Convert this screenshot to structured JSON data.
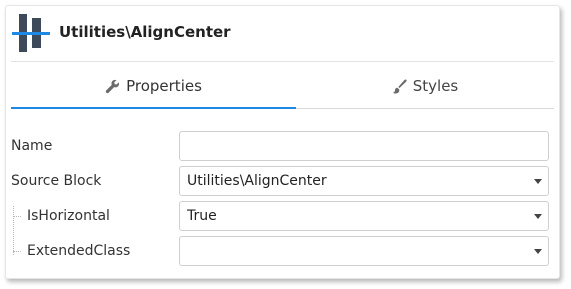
{
  "header": {
    "icon": "align-center-icon",
    "title": "Utilities\\AlignCenter"
  },
  "tabs": [
    {
      "label": "Properties",
      "icon": "wrench-icon",
      "active": true
    },
    {
      "label": "Styles",
      "icon": "brush-icon",
      "active": false
    }
  ],
  "properties": [
    {
      "label": "Name",
      "value": "",
      "type": "text"
    },
    {
      "label": "Source Block",
      "value": "Utilities\\AlignCenter",
      "type": "select"
    },
    {
      "label": "IsHorizontal",
      "value": "True",
      "type": "select"
    },
    {
      "label": "ExtendedClass",
      "value": "",
      "type": "select"
    }
  ],
  "colors": {
    "accent": "#1e88e5",
    "icon_dark": "#3c4a5a",
    "icon_blue": "#1e88e5"
  }
}
